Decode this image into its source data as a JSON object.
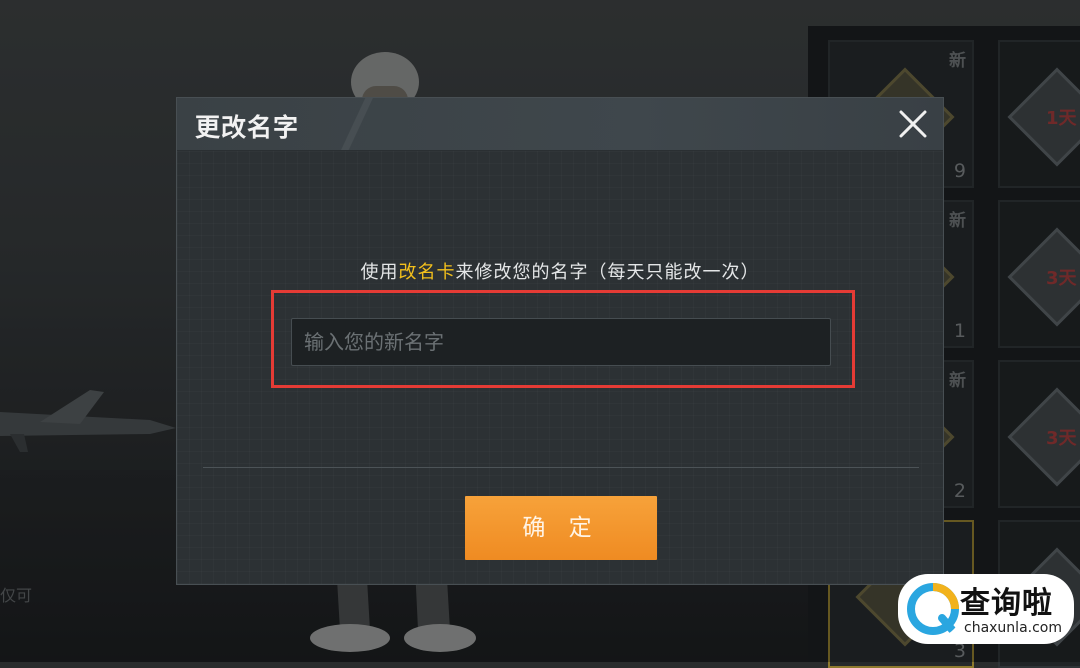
{
  "dialog": {
    "title": "更改名字",
    "instruction_prefix": "使用",
    "instruction_highlight": "改名卡",
    "instruction_suffix": "来修改您的名字（每天只能改一次）",
    "input_placeholder": "输入您的新名字",
    "input_value": "",
    "confirm_label": "确 定"
  },
  "background": {
    "side_text": "仅可"
  },
  "inventory": {
    "slots": [
      {
        "new": "新",
        "count": "9"
      },
      {
        "new": "新",
        "count": "1"
      },
      {
        "new": "新",
        "count": "2"
      },
      {
        "new": "",
        "count": "3"
      }
    ],
    "badges": [
      {
        "days": "1天"
      },
      {
        "days": "3天"
      },
      {
        "days": "3天"
      }
    ]
  },
  "watermark": {
    "title": "查询啦",
    "url": "chaxunla.com"
  },
  "colors": {
    "accent_yellow": "#f3c01c",
    "confirm_orange": "#ef8b22",
    "highlight_red": "#e53b35"
  }
}
